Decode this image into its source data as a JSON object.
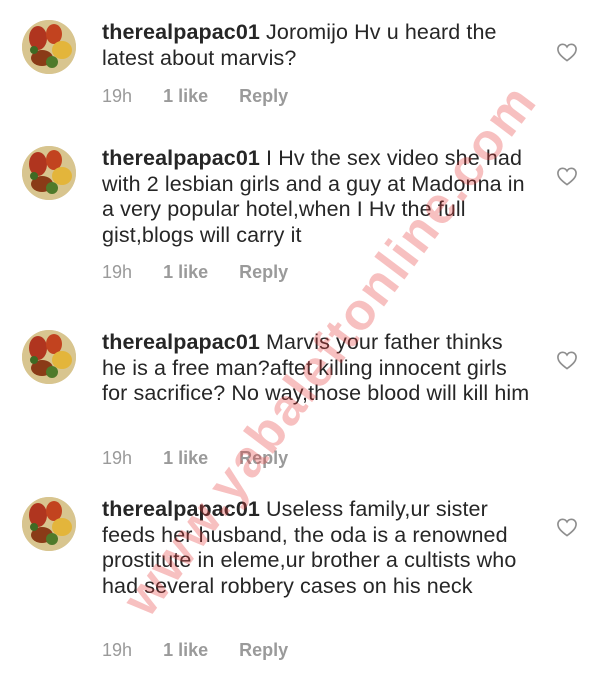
{
  "watermark": "www.yabaleftonline.com",
  "comments": [
    {
      "username": "therealpapac01",
      "text": "Joromijo Hv u heard the latest about marvis?",
      "time": "19h",
      "likes": "1 like",
      "reply": "Reply"
    },
    {
      "username": "therealpapac01",
      "text": "I Hv the sex video she had with 2 lesbian girls and a guy at Madonna in a very popular hotel,when I Hv the full gist,blogs will carry it",
      "time": "19h",
      "likes": "1 like",
      "reply": "Reply"
    },
    {
      "username": "therealpapac01",
      "text": "Marvis your father thinks he is a free man?aftet killing innocent girls for sacrifice? No way,those blood will kill him",
      "time": "19h",
      "likes": "1 like",
      "reply": "Reply"
    },
    {
      "username": "therealpapac01",
      "text": "Useless family,ur sister feeds her husband, the oda is a renowned prostitute in eleme,ur brother a cultists who had several robbery cases on his neck",
      "time": "19h",
      "likes": "1 like",
      "reply": "Reply"
    }
  ]
}
